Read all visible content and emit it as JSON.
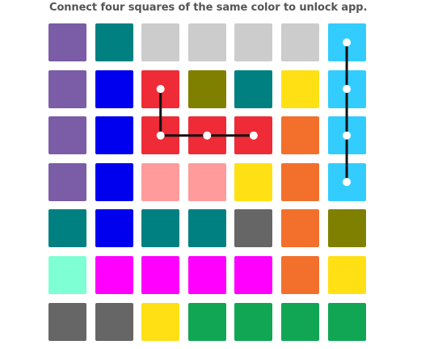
{
  "instruction": "Connect four squares of the same color to unlock app.",
  "colors": {
    "purple": "#7b5ca7",
    "teal": "#008080",
    "lightgray": "#cccccc",
    "skyblue": "#33ccff",
    "blue": "#0000ee",
    "red": "#ee2b37",
    "olive": "#808000",
    "yellow": "#ffe014",
    "orange": "#f2702c",
    "pink": "#ff9b9b",
    "darkgray": "#666666",
    "mint": "#7fffd4",
    "magenta": "#ff00ff",
    "green": "#11a653",
    "link_line": "#111111",
    "link_dot": "#ffffff"
  },
  "grid": [
    [
      "purple",
      "teal",
      "lightgray",
      "lightgray",
      "lightgray",
      "lightgray",
      "skyblue"
    ],
    [
      "purple",
      "blue",
      "red",
      "olive",
      "teal",
      "yellow",
      "skyblue"
    ],
    [
      "purple",
      "blue",
      "red",
      "red",
      "red",
      "orange",
      "skyblue"
    ],
    [
      "purple",
      "blue",
      "pink",
      "pink",
      "yellow",
      "orange",
      "skyblue"
    ],
    [
      "teal",
      "blue",
      "teal",
      "teal",
      "darkgray",
      "orange",
      "olive"
    ],
    [
      "mint",
      "magenta",
      "magenta",
      "magenta",
      "magenta",
      "orange",
      "yellow"
    ],
    [
      "darkgray",
      "darkgray",
      "yellow",
      "green",
      "green",
      "green",
      "green"
    ]
  ],
  "connections": [
    {
      "color": "skyblue",
      "cells": [
        [
          0,
          6
        ],
        [
          1,
          6
        ],
        [
          2,
          6
        ],
        [
          3,
          6
        ]
      ]
    },
    {
      "color": "red",
      "cells": [
        [
          1,
          2
        ],
        [
          2,
          2
        ],
        [
          2,
          3
        ],
        [
          2,
          4
        ]
      ]
    }
  ]
}
